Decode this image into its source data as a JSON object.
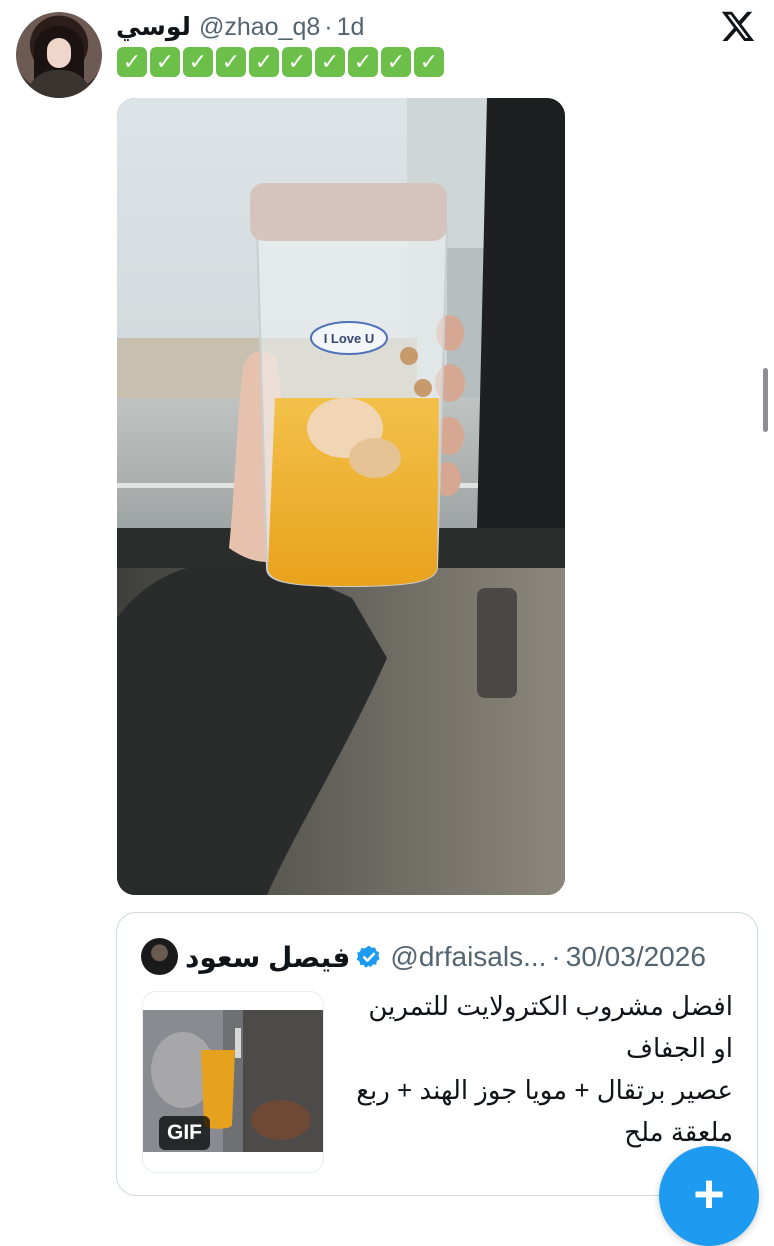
{
  "tweet": {
    "display_name": "لوسي",
    "handle": "@zhao_q8",
    "separator": "·",
    "time": "1d",
    "check_emoji": "✅",
    "check_count": 10,
    "photo_alt": "",
    "cup_text": "I Love U"
  },
  "quote": {
    "display_name": "فيصل سعود",
    "verified": true,
    "handle": "@drfaisals...",
    "separator": "·",
    "date": "30/03/2026",
    "text_lines": [
      "افضل مشروب الكترولايت للتمرين",
      "او الجفاف",
      "عصير برتقال + مويا جوز الهند + ربع",
      "ملعقة ملح"
    ],
    "media_badge": "GIF"
  },
  "fab": {
    "label": "+"
  },
  "colors": {
    "accent": "#1d9bf0",
    "secondary_text": "#536471",
    "border": "#cfd9de",
    "check_green": "#6cc04a"
  },
  "icons": {
    "logo": "x-logo-icon",
    "verified": "verified-badge-icon",
    "compose": "plus-icon"
  }
}
